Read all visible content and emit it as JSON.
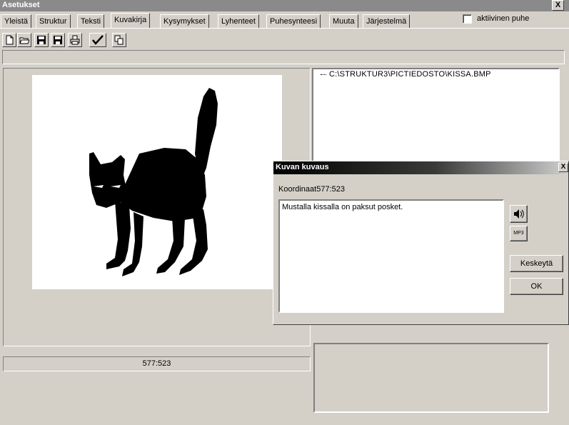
{
  "window": {
    "title": "Asetukset",
    "close_label": "X"
  },
  "tabs": [
    {
      "label": "Yleistä",
      "active": false
    },
    {
      "label": "Struktur",
      "active": false
    },
    {
      "label": "Teksti",
      "active": false
    },
    {
      "label": "Kuvakirja",
      "active": true
    },
    {
      "label": "Kysymykset",
      "active": false
    },
    {
      "label": "Lyhenteet",
      "active": false
    },
    {
      "label": "Puhesynteesi",
      "active": false
    },
    {
      "label": "Muuta",
      "active": false
    },
    {
      "label": "Järjestelmä",
      "active": false
    }
  ],
  "speech_toggle": {
    "label": "aktiivinen puhe",
    "checked": false
  },
  "toolbar": {
    "buttons": [
      "new-file-icon",
      "open-folder-icon",
      "save-icon",
      "save-as-icon",
      "print-icon",
      "checkmark-icon",
      "copy-icon"
    ]
  },
  "tree": {
    "item": "C:\\STRUKTUR3\\PICTIEDOSTO\\KISSA.BMP"
  },
  "coordinates": "577:523",
  "dialog": {
    "title": "Kuvan kuvaus",
    "close_label": "X",
    "coord_label": "Koordinaat577:523",
    "description": "Mustalla kissalla on paksut posket.",
    "mp3_label": "MP3",
    "cancel_label": "Keskeytä",
    "ok_label": "OK"
  }
}
